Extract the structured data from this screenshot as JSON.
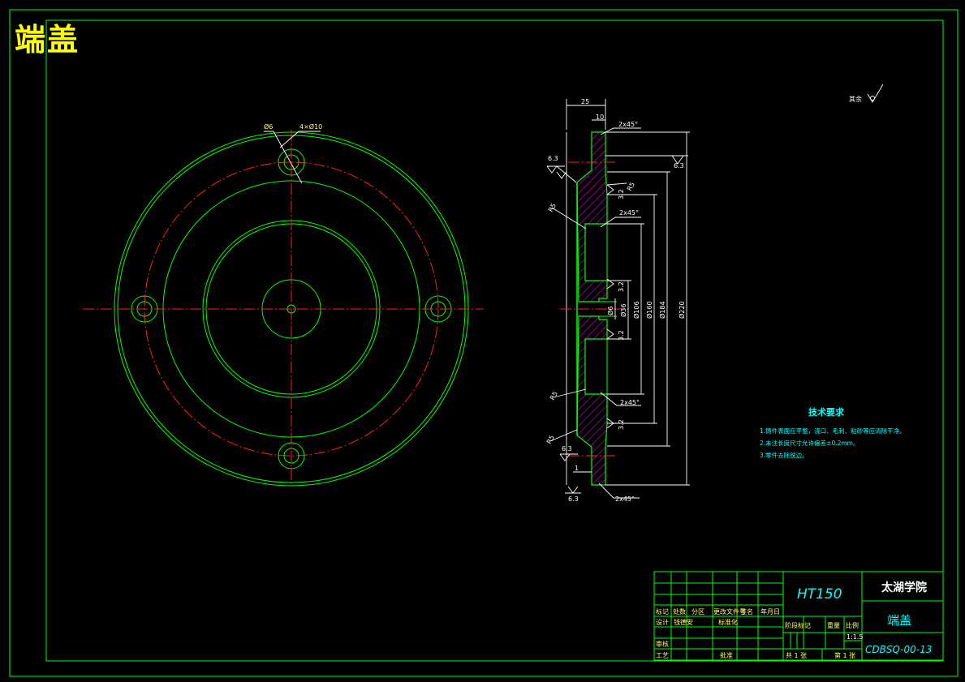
{
  "drawing_title": "端盖",
  "front_view": {
    "label_hole_small": "Ø6",
    "label_holes": "4×Ø10"
  },
  "section_view": {
    "width_dim": "25",
    "step_dim": "10",
    "step_dim_bottom": "1",
    "chamfers": [
      "2x45°",
      "2x45°",
      "2x45°",
      "2x45°"
    ],
    "roughness_top_left": "6.3",
    "roughness_right": "6.3",
    "roughness_mid_left": "6.3",
    "roughness_bottom": "6.3",
    "roughness_inner": [
      "3.2",
      "3.2",
      "3.2",
      "3.2"
    ],
    "radii": [
      "R5",
      "R5",
      "R5",
      "R5"
    ],
    "diameters": [
      "Ø6",
      "Ø36",
      "Ø106",
      "Ø160",
      "Ø184",
      "Ø220"
    ]
  },
  "surface_note": {
    "label": "其余",
    "symbol": "✓"
  },
  "tech_requirements": {
    "heading": "技术要求",
    "items": [
      "1.铸件表面应平整，浇口、毛刺、粘砂等应清除干净。",
      "2.未注长度尺寸允许偏差±0.2mm。",
      "3.零件去除锐边。"
    ]
  },
  "title_block": {
    "material": "HT150",
    "school": "太湖学院",
    "part_name": "端盖",
    "drawing_number": "CDBSQ-00-13",
    "row_labels": [
      "标记",
      "处数",
      "分区",
      "更改文件号",
      "签名",
      "年月日"
    ],
    "designer_label": "设计",
    "designer_name": "钱德安",
    "standardization_label": "标准化",
    "review_label": "审核",
    "process_label": "工艺",
    "approve_label": "批准",
    "stage_label": "阶段标记",
    "weight_label": "重量",
    "scale_label": "比例",
    "scale_value": "1:1.5",
    "sheets_total": "共 1 张",
    "sheet_current": "第 1 张"
  },
  "colors": {
    "background": "#000000",
    "outline": "#00ff00",
    "centerline": "#ff2020",
    "dimension": "#ffffff",
    "title": "#ffff00",
    "hatch": "#b000b0",
    "text_cyan": "#00ffff"
  }
}
